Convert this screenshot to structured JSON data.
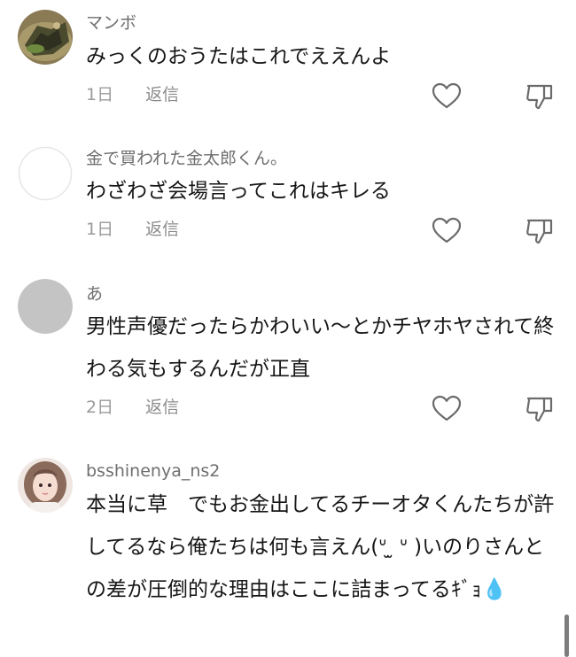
{
  "comments": [
    {
      "username": "マンボ",
      "text": "みっくのおうたはこれでええんよ",
      "date": "1日",
      "reply_label": "返信"
    },
    {
      "username": "金で買われた金太郎くん。",
      "text": "わざわざ会場言ってこれはキレる",
      "date": "1日",
      "reply_label": "返信"
    },
    {
      "username": "あ",
      "text": "男性声優だったらかわいい〜とかチヤホヤされて終わる気もするんだが正直",
      "date": "2日",
      "reply_label": "返信"
    },
    {
      "username": "bsshinenya_ns2",
      "text": "本当に草　でもお金出してるチーオタくんたちが許してるなら俺たちは何も言えん(ᐡ ̫ ᐡ )いのりさんとの差が圧倒的な理由はここに詰まってる",
      "text_suffix": "ｷﾞｮ💧",
      "date": "",
      "reply_label": ""
    }
  ],
  "icons": {
    "like": "heart-outline-icon",
    "dislike": "thumbs-down-outline-icon"
  }
}
